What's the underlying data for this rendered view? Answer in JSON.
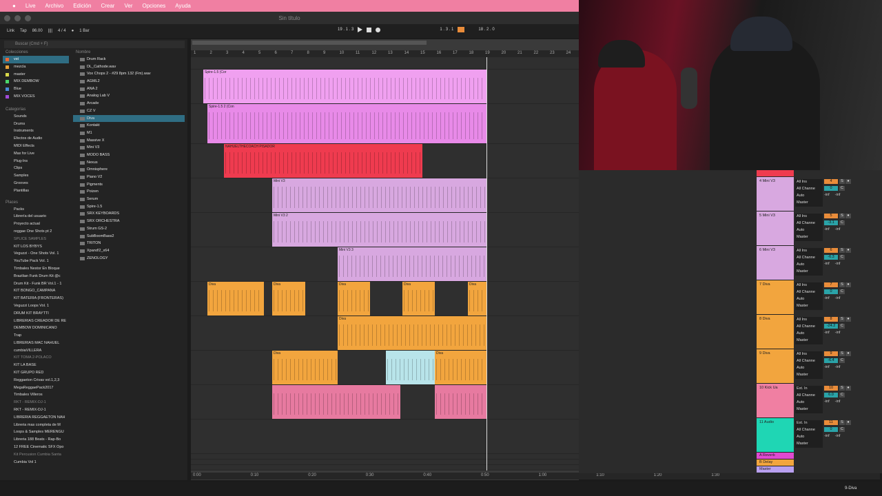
{
  "menubar": {
    "items": [
      "Live",
      "Archivo",
      "Edición",
      "Crear",
      "Ver",
      "Opciones",
      "Ayuda"
    ]
  },
  "window": {
    "title": "Sin título"
  },
  "control": {
    "link": "Link",
    "tap": "Tap",
    "tempo": "86.00",
    "signature": "4 / 4",
    "quantize": "1 Bar",
    "position": "19 . 1 . 3",
    "loop_start": "1 . 3 . 1",
    "loop_length": "18 . 2 . 0"
  },
  "browser": {
    "search_placeholder": "Buscar (Cmd + F)",
    "collections_title": "Colecciones",
    "collections": [
      "vst",
      "mezcla",
      "master",
      "MIX DEMBOW",
      "Blue",
      "MIX VOCES"
    ],
    "categories_title": "Categorías",
    "categories": [
      "Sounds",
      "Drums",
      "Instruments",
      "Efectos de Audio",
      "MIDI Effects",
      "Max for Live",
      "Plug-Ins",
      "Clips",
      "Samples",
      "Grooves",
      "Plantillas"
    ],
    "places_title": "Places",
    "places": [
      "Packs",
      "Librería del usuario",
      "Proyecto actual",
      "reggae One Shots pt 2",
      "SPLICE SAMPLES",
      "KIT LOS BYBYS",
      "Veguzzi - One Shots Vol. 1",
      "YouTube Pack Vol. 1",
      "Timbales Nestor En Bloque",
      "Brazilian Funk Drum Kit @c",
      "Drum Kit - Funk BR Vol.1 - 1",
      "KIT BONGO_CAMPANA",
      "KIT BATERIA (FRONTERAS)",
      "Veguzzi Loops Vol. 1",
      "DRUM KIT BRAYTTI",
      "LIBRERIAS CREADOR DE RE",
      "DEMBOW DOMINICANO",
      "Trap",
      "LIBRERIAS MAC NAHUEL",
      "cumbiaVILLERA",
      "KIT TOMA 2-POLACO",
      "KIT LA BASE",
      "KIT GRUPO RED",
      "Reggaeton Crivas vol.1,2,3",
      "MegaReggaePack2017",
      "Timbales Villeros",
      "RKT - REMIX-DJ-1",
      "RKT - REMIX-DJ-1",
      "LIBRERIA REGGAETON NAH",
      "Libreria mas completa de M",
      "Loops & Samples MERENGU",
      "Libreria 188 Beats - Rap-Bo",
      "12 FREE Cinematic SFX Opo",
      "Kit Percusion Cumbia Santa",
      "Cumbia Vol 1"
    ],
    "name_header": "Nombre",
    "files": [
      "Drum Rack",
      "DL_Cathode.wav",
      "Vox Chops 2 - #29 8pm 132 (Fm).wav",
      "AGML2",
      "ANA 2",
      "Analog Lab V",
      "Arcade",
      "CZ V",
      "Diva",
      "Kontakt",
      "M1",
      "Massive X",
      "Mini V3",
      "MODO BASS",
      "Nexus",
      "Omnisphere",
      "Piano V2",
      "Pigments",
      "Poizen",
      "Serum",
      "Spire-1.5",
      "SRX KEYBOARDS",
      "SRX ORCHESTRA",
      "Strum GS-2",
      "SubBoomBass2",
      "TRITON",
      "Xpand!2_x64",
      "ZENOLOGY"
    ]
  },
  "ruler": {
    "bars": [
      "1",
      "2",
      "3",
      "4",
      "5",
      "6",
      "7",
      "8",
      "9",
      "10",
      "11",
      "12",
      "13",
      "14",
      "15",
      "16",
      "17",
      "18",
      "19",
      "20",
      "21",
      "22",
      "23",
      "24"
    ]
  },
  "timeline": {
    "times": [
      "0:00",
      "0:10",
      "0:20",
      "0:30",
      "0:40",
      "0:50",
      "1:00",
      "1:10",
      "1:20",
      "1:30"
    ]
  },
  "clips": {
    "spire1": "Spire-1.5 (Cor",
    "spire2": "Spire-1.5 2 (Con",
    "nahuel": "NAHUELTHECOACH PISADOR",
    "minivf": "Mini V3",
    "minivf2": "Mini V3 2",
    "minivf3": "Mini V3 3",
    "diva": "Diva"
  },
  "mixer": {
    "tracks": [
      {
        "name": "4 Mini V3",
        "num": "4",
        "vol": "0",
        "color": "#d8a8e0"
      },
      {
        "name": "5 Mini V3",
        "num": "5",
        "vol": "-3.1",
        "color": "#d8a8e0"
      },
      {
        "name": "6 Mini V3",
        "num": "6",
        "vol": "-6.3",
        "color": "#d8a8e0"
      },
      {
        "name": "7 Diva",
        "num": "7",
        "vol": "0",
        "color": "#f2a53e"
      },
      {
        "name": "8 Diva",
        "num": "8",
        "vol": "-24.2",
        "color": "#f2a53e"
      },
      {
        "name": "9 Diva",
        "num": "9",
        "vol": "-6.4",
        "color": "#f2a53e"
      },
      {
        "name": "10 Kick Ua",
        "num": "10",
        "vol": "6.0",
        "color": "#f07fa2"
      },
      {
        "name": "11 Audio",
        "num": "11",
        "vol": "0",
        "color": "#1fd6b4"
      }
    ],
    "returns": [
      "A Reverb",
      "B Delay",
      "Master"
    ],
    "input_all": "All Ins",
    "input_ext": "Ext. In",
    "channel": "All Channe",
    "out": "Master",
    "auto": "Auto",
    "off": "Off",
    "in": "In",
    "inf": "-inf"
  },
  "status": {
    "selected": "9-Diva"
  }
}
